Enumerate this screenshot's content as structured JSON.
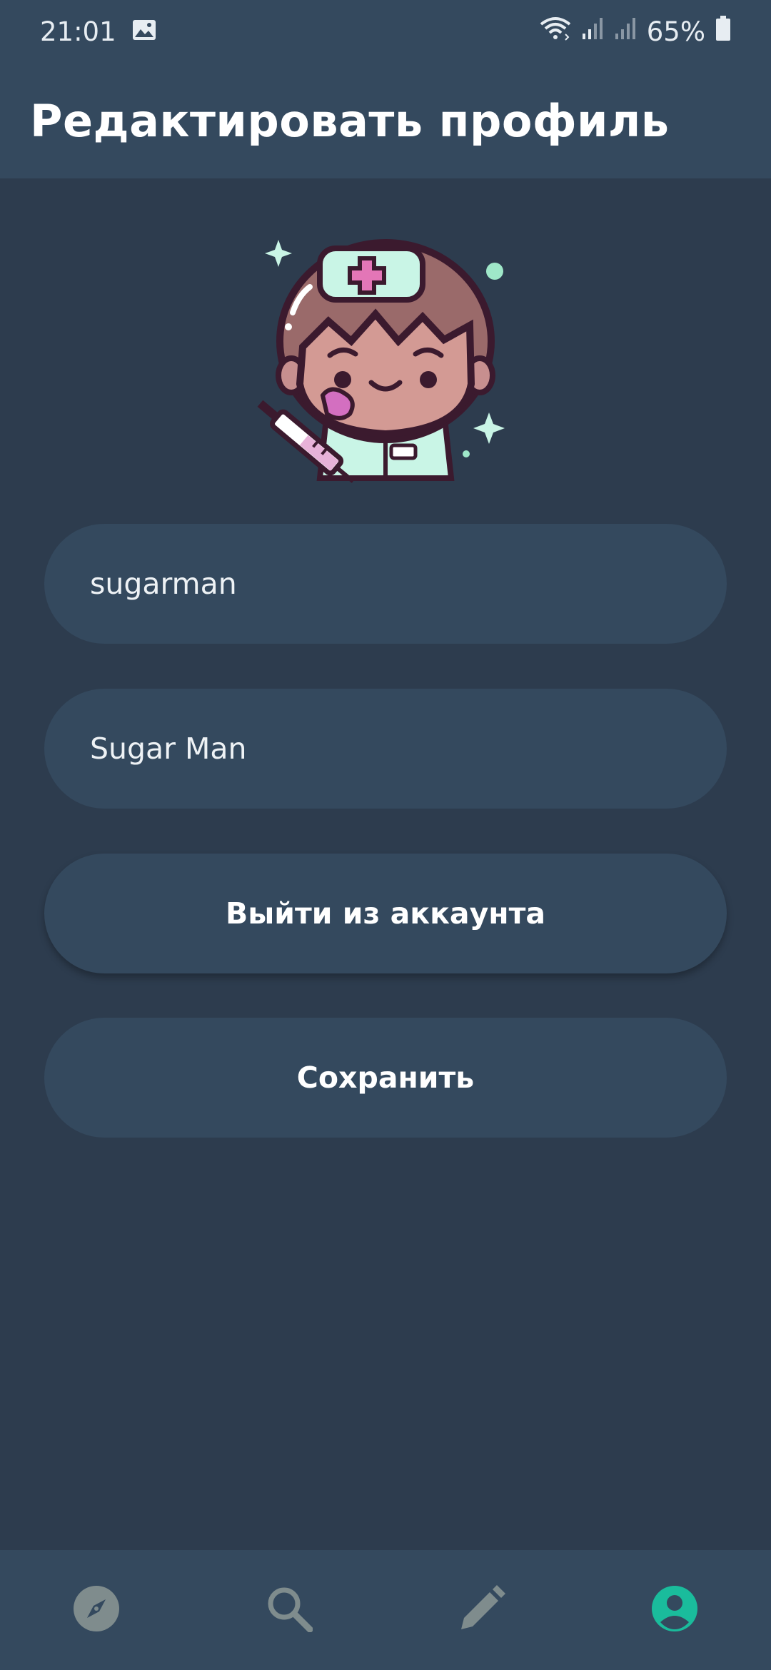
{
  "status_bar": {
    "time": "21:01",
    "battery": "65%",
    "icons": [
      "image-icon",
      "wifi-icon",
      "signal-icon",
      "signal-icon",
      "battery-icon"
    ]
  },
  "app_bar": {
    "title": "Редактировать профиль"
  },
  "profile": {
    "avatar_icon": "nurse-avatar-icon",
    "username_value": "sugarman",
    "name_value": "Sugar Man"
  },
  "actions": {
    "logout_label": "Выйти из аккаунта",
    "save_label": "Сохранить"
  },
  "bottom_nav": {
    "items": [
      "compass-icon",
      "search-icon",
      "pencil-icon",
      "account-icon"
    ],
    "active": "account-icon"
  },
  "colors": {
    "background": "#2d3c4e",
    "surface": "#34495e",
    "accent": "#1abc9c",
    "inactive_icon": "#7f8c8d"
  }
}
